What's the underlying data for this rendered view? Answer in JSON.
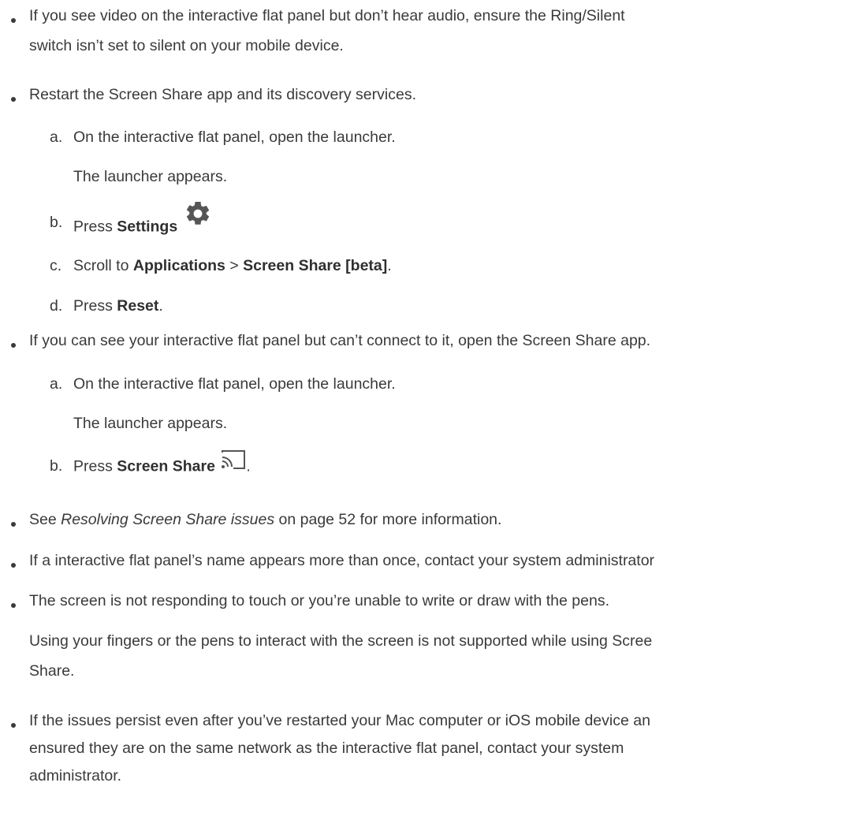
{
  "bullets": [
    {
      "line1": "If you see video on the interactive flat panel but don’t hear audio, ensure the Ring/Silent",
      "line2": "switch isn’t set to silent on your mobile device."
    },
    {
      "line1": "Restart the Screen Share app and its discovery services."
    },
    {
      "line1": "If you can see your interactive flat panel but can’t connect to it, open the Screen Share app."
    },
    {
      "pre": "See ",
      "link": "Resolving Screen Share issues",
      "post": " on page 52 for more information."
    },
    {
      "line1": "If a interactive flat panel’s name appears more than once, contact your system administrator"
    },
    {
      "line1": "The screen is not responding to touch or you’re unable to write or draw with the pens.",
      "para1": "Using your fingers or the pens to interact with the screen is not supported while using Scree",
      "para2": "Share."
    },
    {
      "line1": "If the issues persist even after you’ve restarted your Mac computer or iOS mobile device an",
      "line2": "ensured they are on the same network as the interactive flat panel, contact your system",
      "line3": "administrator."
    }
  ],
  "steps_restart": [
    {
      "letter": "a.",
      "text": "On the interactive flat panel, open the launcher.",
      "result": "The launcher appears."
    },
    {
      "letter": "b.",
      "pre": "Press ",
      "bold": "Settings"
    },
    {
      "letter": "c.",
      "pre": "Scroll to ",
      "bold1": "Applications",
      "mid": " > ",
      "bold2": "Screen Share [beta]",
      "post": "."
    },
    {
      "letter": "d.",
      "pre": "Press ",
      "bold": "Reset",
      "post": "."
    }
  ],
  "steps_connect": [
    {
      "letter": "a.",
      "text": "On the interactive flat panel, open the launcher.",
      "result": "The launcher appears."
    },
    {
      "letter": "b.",
      "pre": "Press ",
      "bold": "Screen Share",
      "post": "."
    }
  ],
  "icons": {
    "settings": "gear-icon",
    "screen_share": "cast-icon"
  }
}
